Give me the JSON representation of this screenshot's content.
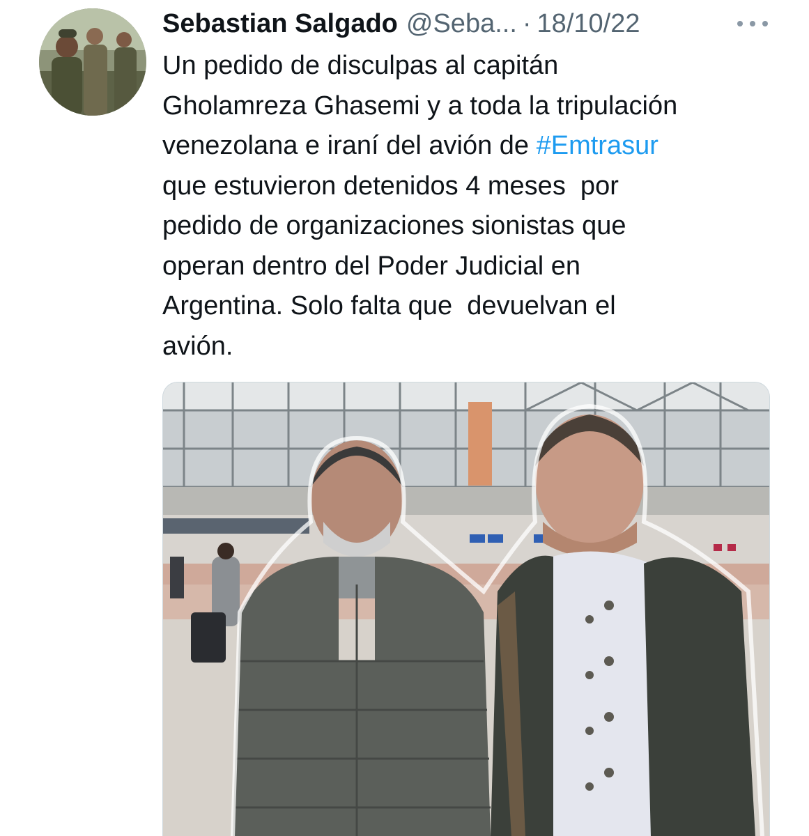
{
  "tweet": {
    "author": {
      "display_name": "Sebastian Salgado",
      "handle": "@Seba...",
      "avatar_icon": "profile-photo"
    },
    "separator": "·",
    "date": "18/10/22",
    "more_icon": "ellipsis-icon",
    "text_lines": [
      "Un pedido de disculpas al capitán",
      "Gholamreza Ghasemi y a toda la tripulación",
      "venezolana e iraní del avión de ",
      "que estuvieron detenidos 4 meses  por",
      "pedido de organizaciones sionistas que",
      "operan dentro del Poder Judicial en",
      "Argentina. Solo falta que  devuelvan el",
      "avión."
    ],
    "hashtag": "#Emtrasur",
    "media": {
      "type": "photo"
    }
  },
  "colors": {
    "text": "#0f1419",
    "secondary": "#536471",
    "link": "#1d9bf0",
    "background": "#ffffff"
  }
}
